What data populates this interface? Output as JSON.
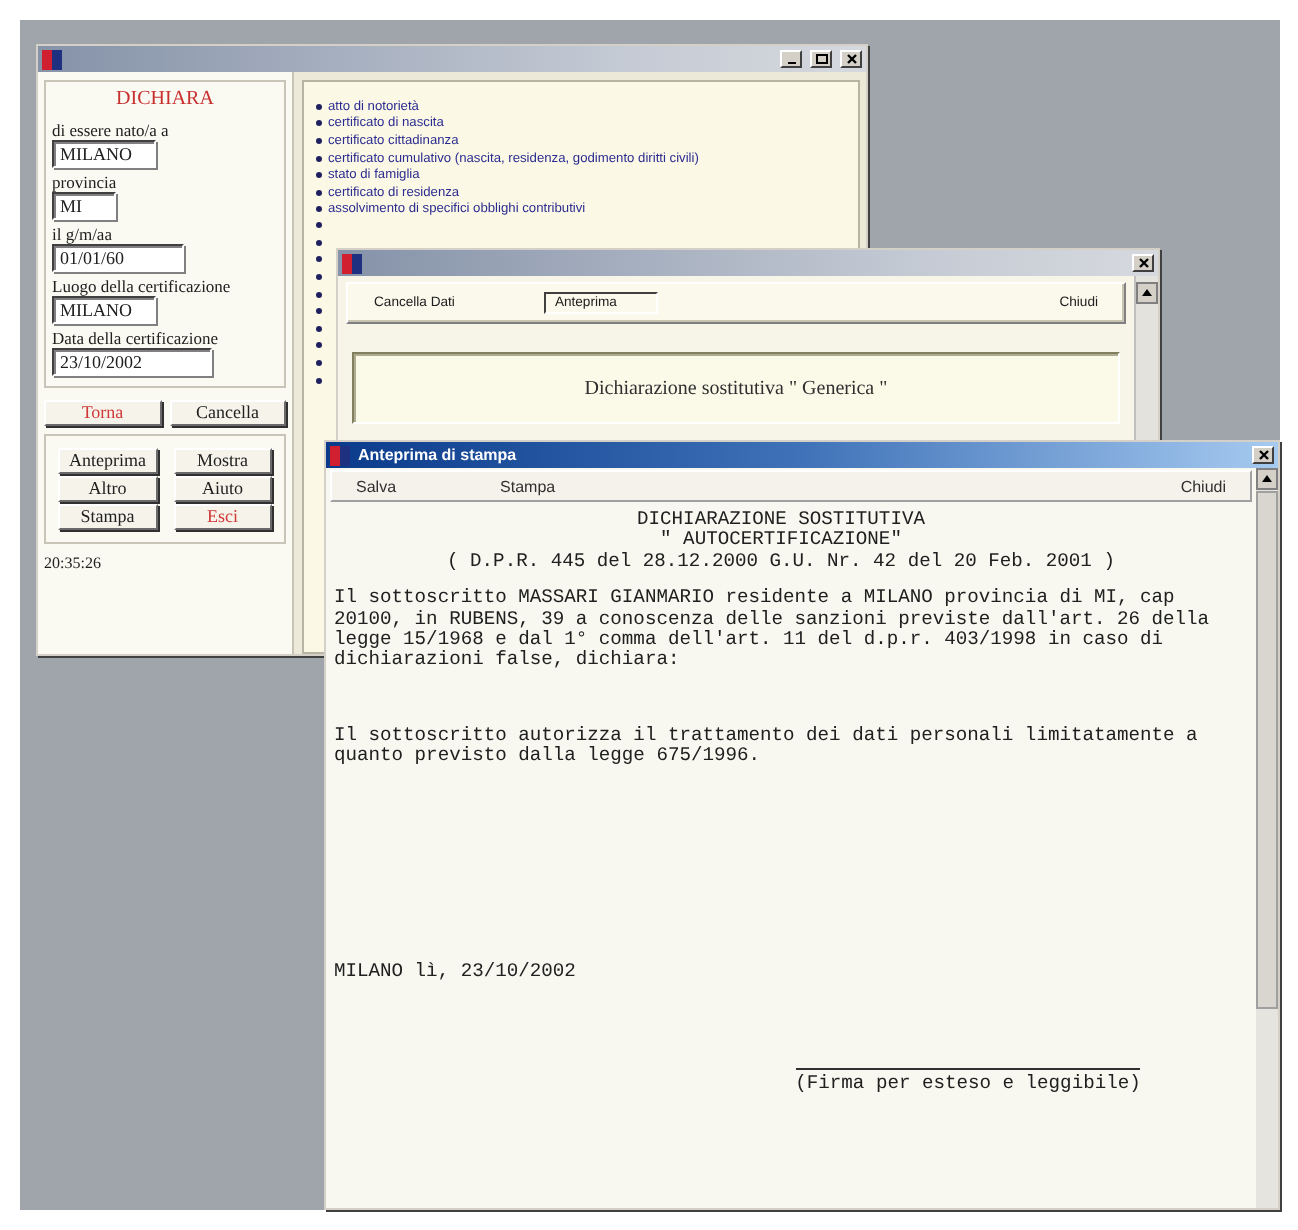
{
  "main_window": {
    "form": {
      "heading": "DICHIARA",
      "fields": [
        {
          "label": "di essere nato/a a",
          "value": "MILANO"
        },
        {
          "label": "provincia",
          "value": "MI"
        },
        {
          "label": "il g/m/aa",
          "value": "01/01/60"
        },
        {
          "label": "Luogo della certificazione",
          "value": "MILANO"
        },
        {
          "label": "Data della certificazione",
          "value": "23/10/2002"
        }
      ],
      "nav_buttons": [
        {
          "label": "Torna",
          "color": "#d03838"
        },
        {
          "label": "Cancella",
          "color": "#202020"
        }
      ],
      "action_buttons": [
        {
          "label": "Anteprima",
          "color": "#202020"
        },
        {
          "label": "Mostra",
          "color": "#202020"
        },
        {
          "label": "Altro",
          "color": "#202020"
        },
        {
          "label": "Aiuto",
          "color": "#202020"
        },
        {
          "label": "Stampa",
          "color": "#202020"
        },
        {
          "label": "Esci",
          "color": "#d03838"
        }
      ],
      "time": "20:35:26"
    },
    "certificates": [
      "atto di notorietà",
      "certificato di nascita",
      "certificato cittadinanza",
      "certificato cumulativo (nascita, residenza, godimento diritti civili)",
      "stato di famiglia",
      "certificato di residenza",
      "assolvimento di specifici obblighi contributivi"
    ]
  },
  "dialog": {
    "toolbar": [
      {
        "label": "Cancella Dati",
        "selected": false
      },
      {
        "label": "Anteprima",
        "selected": true
      },
      {
        "label": "Chiudi",
        "selected": false
      }
    ],
    "caption": "Dichiarazione sostitutiva \" Generica \""
  },
  "preview": {
    "title": "Anteprima di stampa",
    "toolbar": [
      "Salva",
      "Stampa",
      "Chiudi"
    ],
    "heading": [
      "DICHIARAZIONE SOSTITUTIVA",
      "\" AUTOCERTIFICAZIONE\"",
      "( D.P.R. 445 del 28.12.2000 G.U. Nr. 42 del 20 Feb. 2001 )"
    ],
    "paragraphs": [
      [
        "Il sottoscritto MASSARI GIANMARIO residente a MILANO provincia di MI, cap",
        "20100, in RUBENS, 39 a conoscenza delle sanzioni previste dall'art. 26 della",
        "legge 15/1968 e dal 1° comma dell'art. 11 del d.p.r. 403/1998 in caso di",
        "dichiarazioni false, dichiara:"
      ],
      [
        "Il sottoscritto autorizza il trattamento dei dati personali limitatamente a",
        "quanto previsto dalla legge 675/1996."
      ]
    ],
    "place_date": "MILANO lì, 23/10/2002",
    "signature": "(Firma per esteso e leggibile)"
  }
}
